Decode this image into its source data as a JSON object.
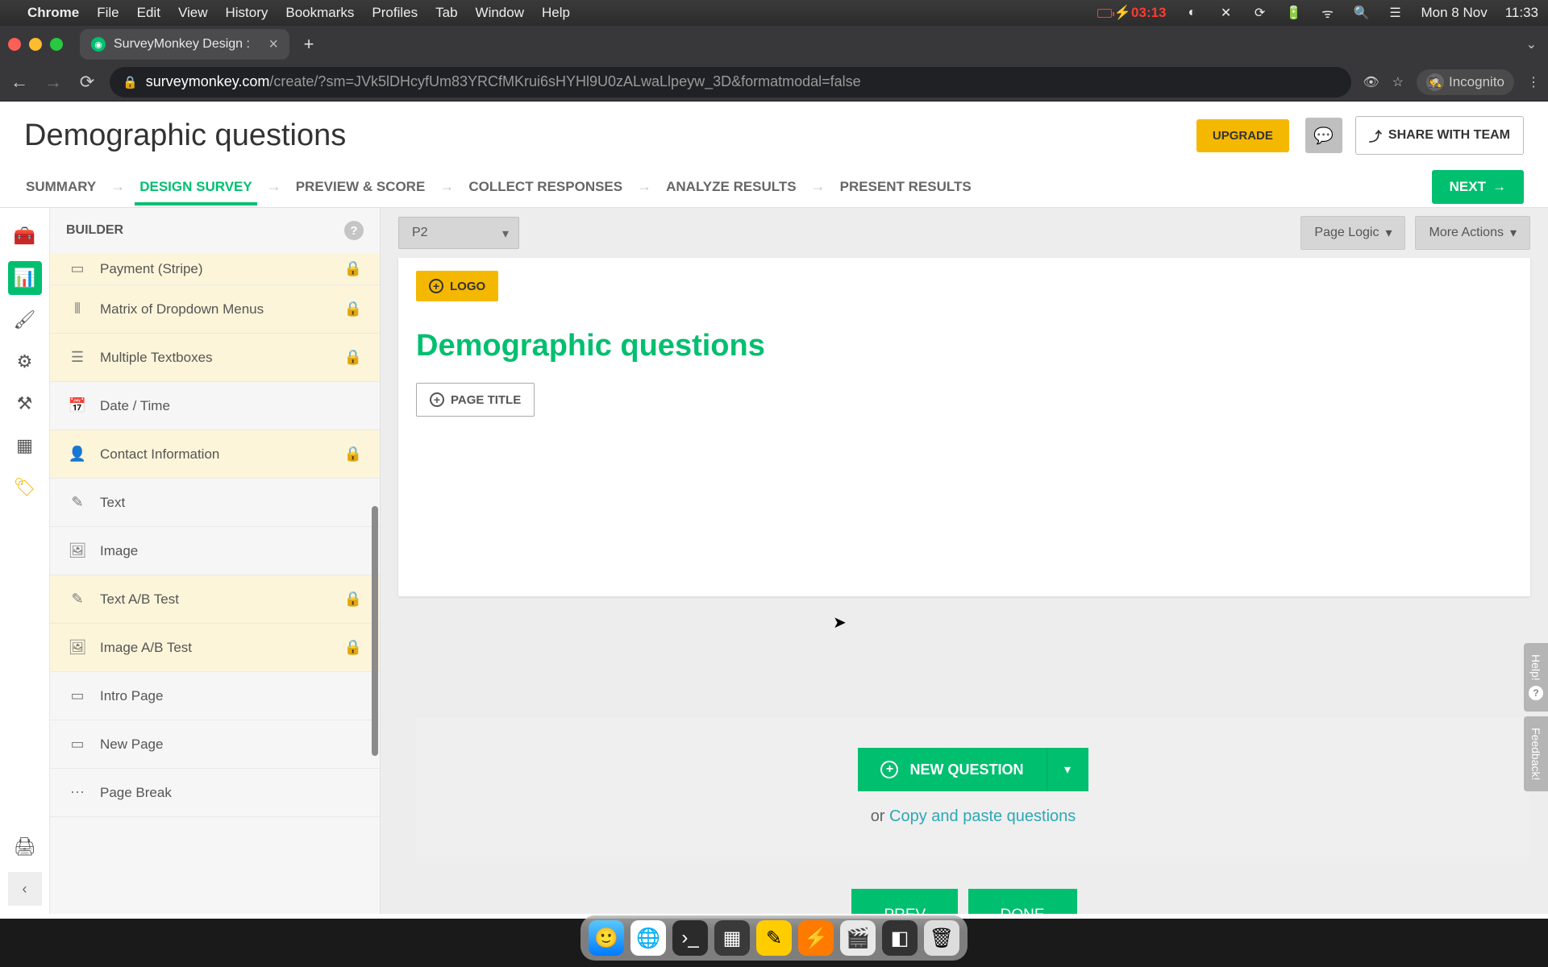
{
  "mac_menu": {
    "app": "Chrome",
    "items": [
      "File",
      "Edit",
      "View",
      "History",
      "Bookmarks",
      "Profiles",
      "Tab",
      "Window",
      "Help"
    ],
    "battery_time": "03:13",
    "date": "Mon 8 Nov",
    "time": "11:33"
  },
  "browser": {
    "tab_title": "SurveyMonkey Design :",
    "url_domain": "surveymonkey.com",
    "url_path": "/create/?sm=JVk5lDHcyfUm83YRCfMKrui6sHYHl9U0zALwaLlpeyw_3D&formatmodal=false",
    "incognito": "Incognito"
  },
  "header": {
    "title": "Demographic questions",
    "upgrade": "UPGRADE",
    "share": "SHARE WITH TEAM"
  },
  "steps": {
    "items": [
      "SUMMARY",
      "DESIGN SURVEY",
      "PREVIEW & SCORE",
      "COLLECT RESPONSES",
      "ANALYZE RESULTS",
      "PRESENT RESULTS"
    ],
    "active_index": 1,
    "next": "NEXT"
  },
  "builder": {
    "title": "BUILDER",
    "items": [
      {
        "label": "Payment (Stripe)",
        "premium": true,
        "icon": "▭"
      },
      {
        "label": "Matrix of Dropdown Menus",
        "premium": true,
        "icon": "⫴"
      },
      {
        "label": "Multiple Textboxes",
        "premium": true,
        "icon": "☰"
      },
      {
        "label": "Date / Time",
        "premium": false,
        "icon": "📅"
      },
      {
        "label": "Contact Information",
        "premium": true,
        "icon": "👤"
      },
      {
        "label": "Text",
        "premium": false,
        "icon": "✎"
      },
      {
        "label": "Image",
        "premium": false,
        "icon": "🖼"
      },
      {
        "label": "Text A/B Test",
        "premium": true,
        "icon": "✎"
      },
      {
        "label": "Image A/B Test",
        "premium": true,
        "icon": "🖼"
      },
      {
        "label": "Intro Page",
        "premium": false,
        "icon": "▭"
      },
      {
        "label": "New Page",
        "premium": false,
        "icon": "▭"
      },
      {
        "label": "Page Break",
        "premium": false,
        "icon": "⋯"
      }
    ]
  },
  "canvas": {
    "page_selector": "P2",
    "page_logic": "Page Logic",
    "more_actions": "More Actions",
    "logo_btn": "LOGO",
    "survey_title": "Demographic questions",
    "page_title_btn": "PAGE TITLE",
    "new_question": "NEW QUESTION",
    "or": "or ",
    "copy_paste": "Copy and paste questions",
    "prev": "PREV",
    "done": "DONE"
  },
  "side_tabs": {
    "help": "Help!",
    "feedback": "Feedback!"
  }
}
